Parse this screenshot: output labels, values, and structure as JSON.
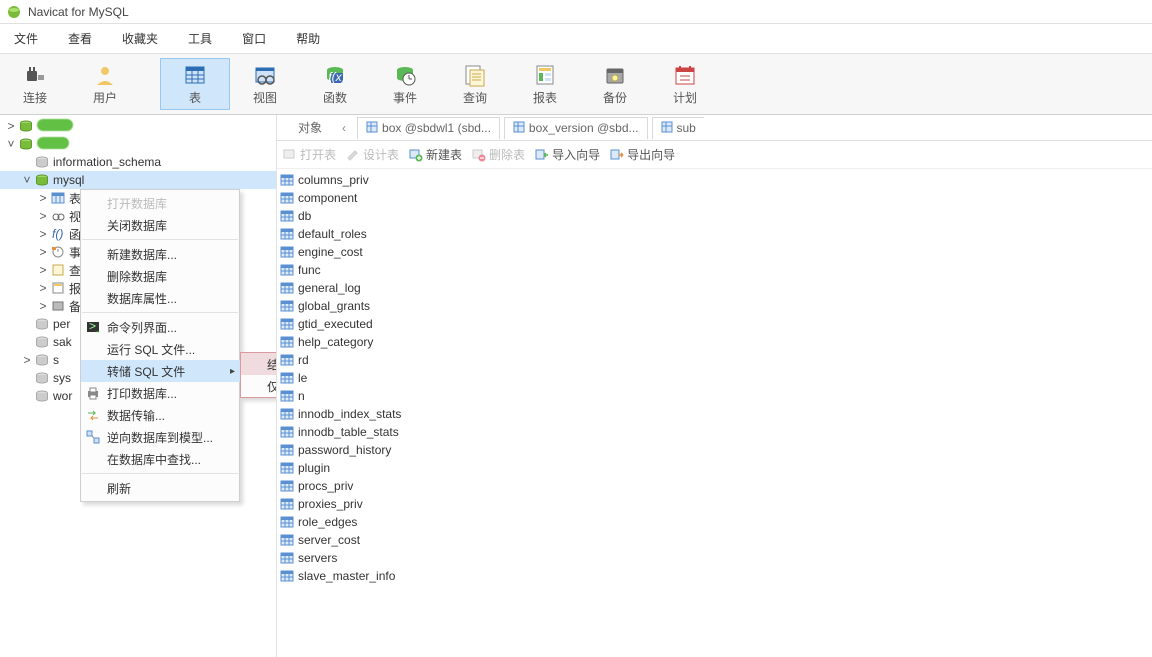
{
  "title": "Navicat for MySQL",
  "menubar": [
    "文件",
    "查看",
    "收藏夹",
    "工具",
    "窗口",
    "帮助"
  ],
  "toolbar": [
    {
      "label": "连接",
      "icon": "plug",
      "active": false
    },
    {
      "label": "用户",
      "icon": "user",
      "active": false
    },
    {
      "label": "表",
      "icon": "table",
      "active": true
    },
    {
      "label": "视图",
      "icon": "view",
      "active": false
    },
    {
      "label": "函数",
      "icon": "fx",
      "active": false
    },
    {
      "label": "事件",
      "icon": "event",
      "active": false
    },
    {
      "label": "查询",
      "icon": "query",
      "active": false
    },
    {
      "label": "报表",
      "icon": "report",
      "active": false
    },
    {
      "label": "备份",
      "icon": "backup",
      "active": false
    },
    {
      "label": "计划",
      "icon": "schedule",
      "active": false
    }
  ],
  "tree": {
    "conn1_open": true,
    "conn2_open": true,
    "db1": "information_schema",
    "db2": "mysql",
    "child_labels": [
      "表",
      "视",
      "函",
      "事",
      "查",
      "报",
      "备"
    ],
    "trunc": [
      "per",
      "sak",
      "s",
      "sys",
      "wor"
    ]
  },
  "tabs": {
    "first": "对象",
    "items": [
      {
        "label": "box @sbdwl1 (sbd..."
      },
      {
        "label": "box_version @sbd..."
      },
      {
        "label": "sub"
      }
    ]
  },
  "actions": {
    "open_table": "打开表",
    "design_table": "设计表",
    "new_table": "新建表",
    "delete_table": "删除表",
    "import": "导入向导",
    "export": "导出向导"
  },
  "tables": [
    "columns_priv",
    "component",
    "db",
    "default_roles",
    "engine_cost",
    "func",
    "general_log",
    "global_grants",
    "gtid_executed",
    "help_category",
    "rd",
    "le",
    "n",
    "innodb_index_stats",
    "innodb_table_stats",
    "password_history",
    "plugin",
    "procs_priv",
    "proxies_priv",
    "role_edges",
    "server_cost",
    "servers",
    "slave_master_info"
  ],
  "ctx": {
    "items": [
      {
        "label": "打开数据库",
        "disabled": true
      },
      {
        "label": "关闭数据库"
      },
      {
        "sep": true
      },
      {
        "label": "新建数据库..."
      },
      {
        "label": "删除数据库"
      },
      {
        "label": "数据库属性..."
      },
      {
        "sep": true
      },
      {
        "label": "命令列界面...",
        "icon": "console"
      },
      {
        "label": "运行 SQL 文件..."
      },
      {
        "label": "转储 SQL 文件",
        "submenu": true,
        "hl": true
      },
      {
        "label": "打印数据库...",
        "icon": "print"
      },
      {
        "label": "数据传输...",
        "icon": "transfer"
      },
      {
        "label": "逆向数据库到模型...",
        "icon": "reverse"
      },
      {
        "label": "在数据库中查找..."
      },
      {
        "sep": true
      },
      {
        "label": "刷新"
      }
    ],
    "submenu": [
      {
        "label": "结构和数据...",
        "hl": true
      },
      {
        "label": "仅结构..."
      }
    ]
  }
}
